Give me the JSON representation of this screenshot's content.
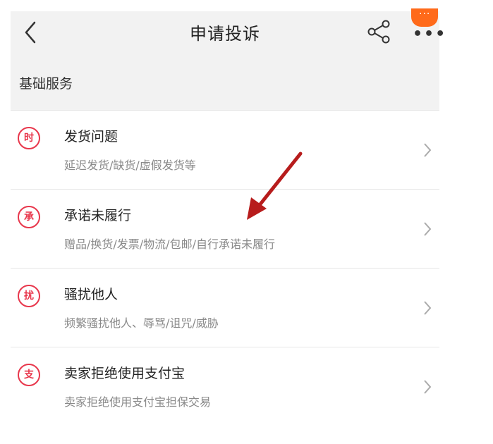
{
  "nav": {
    "title": "申请投诉"
  },
  "section": {
    "label": "基础服务"
  },
  "badge": {
    "dots": "···"
  },
  "rows": [
    {
      "icon_char": "时",
      "title": "发货问题",
      "subtitle": "延迟发货/缺货/虚假发货等"
    },
    {
      "icon_char": "承",
      "title": "承诺未履行",
      "subtitle": "赠品/换货/发票/物流/包邮/自行承诺未履行"
    },
    {
      "icon_char": "扰",
      "title": "骚扰他人",
      "subtitle": "频繁骚扰他人、辱骂/诅咒/威胁"
    },
    {
      "icon_char": "支",
      "title": "卖家拒绝使用支付宝",
      "subtitle": "卖家拒绝使用支付宝担保交易"
    }
  ],
  "colors": {
    "accent": "#e8364b",
    "badge": "#ff6a1a",
    "arrow": "#b71c1c"
  },
  "icons": [
    "back-icon",
    "share-icon",
    "more-icon",
    "chevron-right-icon"
  ]
}
